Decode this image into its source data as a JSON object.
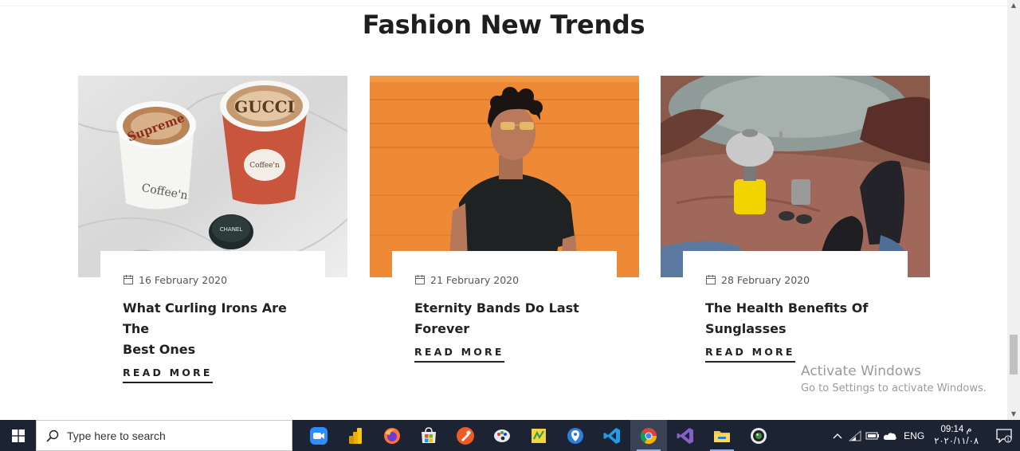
{
  "section": {
    "title": "Fashion New Trends"
  },
  "cards": [
    {
      "date": "16 February 2020",
      "title_line1": "What Curling Irons Are The",
      "title_line2": "Best Ones",
      "read_more": "READ MORE",
      "cup_label_1": "Supreme",
      "cup_label_2": "GUCCI"
    },
    {
      "date": "21 February 2020",
      "title_line1": "Eternity Bands Do Last",
      "title_line2": "Forever",
      "read_more": "READ MORE"
    },
    {
      "date": "28 February 2020",
      "title_line1": "The Health Benefits Of",
      "title_line2": "Sunglasses",
      "read_more": "READ MORE"
    }
  ],
  "watermark": {
    "line1": "Activate Windows",
    "line2": "Go to Settings to activate Windows."
  },
  "taskbar": {
    "search_placeholder": "Type here to search",
    "apps": [
      "zoom-icon",
      "power-bi-icon",
      "firefox-icon",
      "store-icon",
      "postman-icon",
      "paint-icon",
      "sticky-icon",
      "maps-icon",
      "vscode-icon",
      "chrome-icon",
      "visual-studio-icon",
      "file-explorer-icon",
      "camera-app-icon"
    ],
    "lang": "ENG",
    "time": "09:14 م",
    "date": "٢٠٢٠/١١/٠٨"
  },
  "colors": {
    "taskbar": "#1c2433",
    "orange_bg": "#ee8a35",
    "text_dark": "#222222"
  }
}
